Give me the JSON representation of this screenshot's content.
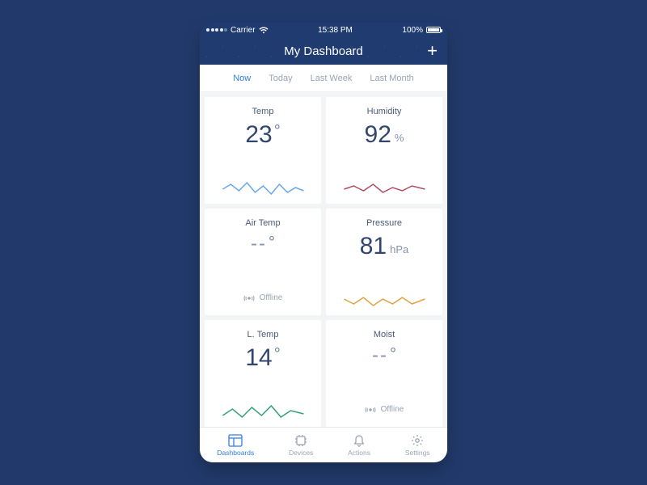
{
  "statusbar": {
    "carrier": "Carrier",
    "time": "15:38 PM",
    "battery": "100%"
  },
  "header": {
    "title": "My Dashboard"
  },
  "tabs": [
    {
      "label": "Now",
      "active": true
    },
    {
      "label": "Today",
      "active": false
    },
    {
      "label": "Last Week",
      "active": false
    },
    {
      "label": "Last Month",
      "active": false
    }
  ],
  "cards": {
    "temp": {
      "label": "Temp",
      "value": "23",
      "unit": "°",
      "online": true,
      "spark_color": "#2f7de1"
    },
    "humidity": {
      "label": "Humidity",
      "value": "92",
      "unit": "%",
      "online": true,
      "spark_color": "#b54a63"
    },
    "airtemp": {
      "label": "Air Temp",
      "value": "--",
      "unit": "°",
      "online": false,
      "offline_label": "Offline"
    },
    "pressure": {
      "label": "Pressure",
      "value": "81",
      "unit": "hPa",
      "online": true,
      "spark_color": "#e0a23f"
    },
    "ltemp": {
      "label": "L. Temp",
      "value": "14",
      "unit": "°",
      "online": true,
      "spark_color": "#34a07a"
    },
    "moist": {
      "label": "Moist",
      "value": "--",
      "unit": "°",
      "online": false,
      "offline_label": "Offline"
    }
  },
  "bottomnav": {
    "dashboards": "Dashboards",
    "devices": "Devices",
    "actions": "Actions",
    "settings": "Settings"
  }
}
